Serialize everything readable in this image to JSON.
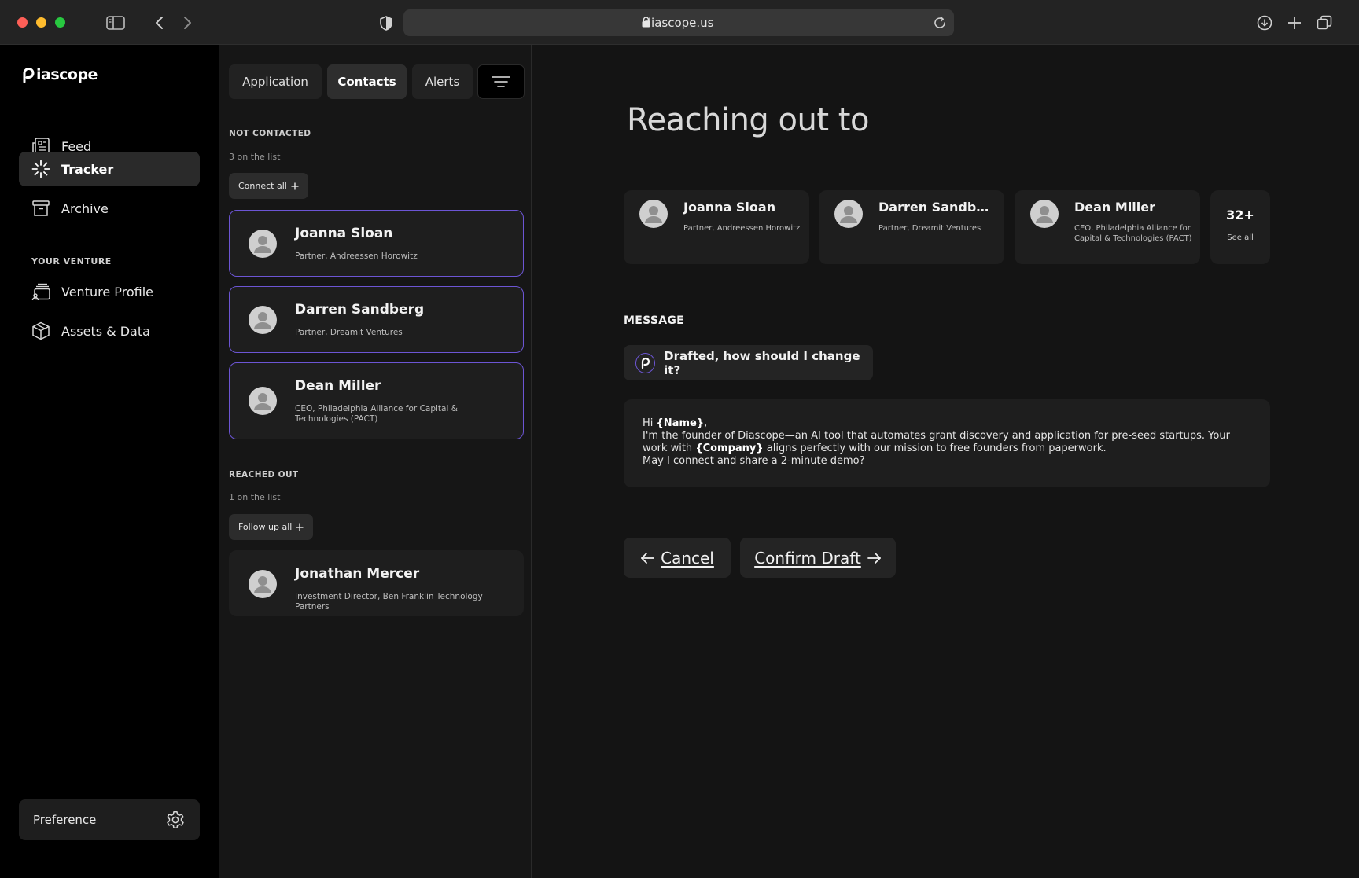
{
  "browser": {
    "url": "diascope.us"
  },
  "sidebar": {
    "brand": "Diascope",
    "logo_text": "iascope",
    "items": [
      {
        "label": "Feed",
        "icon": "newspaper-icon"
      },
      {
        "label": "Tracker",
        "icon": "loader-icon",
        "active": true
      },
      {
        "label": "Archive",
        "icon": "archive-box-icon"
      }
    ],
    "section_label": "YOUR VENTURE",
    "venture_items": [
      {
        "label": "Venture Profile",
        "icon": "profile-stack-icon"
      },
      {
        "label": "Assets & Data",
        "icon": "cube-icon"
      }
    ],
    "preference_label": "Preference"
  },
  "contacts": {
    "tabs": [
      {
        "label": "Application"
      },
      {
        "label": "Contacts",
        "active": true
      },
      {
        "label": "Alerts"
      }
    ],
    "not_contacted": {
      "label": "NOT CONTACTED",
      "count": "3 on the list",
      "action": "Connect all",
      "people": [
        {
          "name": "Joanna Sloan",
          "role": "Partner, Andreessen Horowitz"
        },
        {
          "name": "Darren Sandberg",
          "role": "Partner, Dreamit Ventures"
        },
        {
          "name": "Dean Miller",
          "role": "CEO, Philadelphia Alliance for Capital & Technologies (PACT)"
        }
      ]
    },
    "reached_out": {
      "label": "REACHED OUT",
      "count": "1 on the list",
      "action": "Follow up all",
      "people": [
        {
          "name": "Jonathan Mercer",
          "role": "Investment Director, Ben Franklin Technology Partners"
        }
      ]
    }
  },
  "main": {
    "heading": "Reaching out to",
    "recipients": [
      {
        "name": "Joanna Sloan",
        "role": "Partner, Andreessen Horowitz"
      },
      {
        "name": "Darren Sandberg",
        "role": "Partner, Dreamit Ventures"
      },
      {
        "name": "Dean Miller",
        "role": "CEO, Philadelphia Alliance for Capital & Technologies (PACT)"
      }
    ],
    "more_count": "32+",
    "more_link": "See all",
    "message_label": "MESSAGE",
    "draft_prompt": "Drafted, how should I change it?",
    "message": {
      "greeting": "Hi ",
      "name_token": "{Name}",
      "greeting_end": ",",
      "line1": "I'm the founder of Diascope—an AI tool that automates grant discovery and application for pre-seed startups. Your work with ",
      "company_token": "{Company}",
      "line2": " aligns perfectly with our mission to free founders from paperwork.",
      "line3": "May I connect and share a 2-minute demo?"
    },
    "cancel_label": "Cancel",
    "confirm_label": "Confirm Draft"
  },
  "colors": {
    "accent": "#6c55d4",
    "traffic_red": "#fe5f57",
    "traffic_yellow": "#febc2e",
    "traffic_green": "#28c840"
  }
}
